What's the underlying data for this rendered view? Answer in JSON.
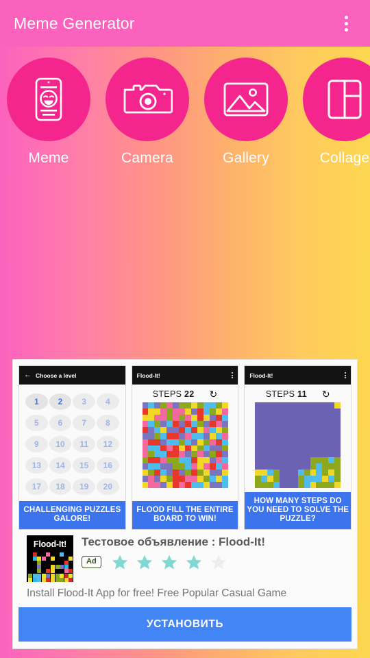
{
  "appbar": {
    "title": "Meme Generator",
    "overflow_icon": "more-vert-icon"
  },
  "shortcuts": [
    {
      "label": "Meme",
      "icon": "phone-smiley-icon"
    },
    {
      "label": "Camera",
      "icon": "camera-icon"
    },
    {
      "label": "Gallery",
      "icon": "image-icon"
    },
    {
      "label": "Collage",
      "icon": "collage-grid-icon"
    }
  ],
  "colors": {
    "appbar": "#FB62BE",
    "circle": "#F4268E",
    "gradient_start": "#FC62BE",
    "gradient_end": "#FDD74F",
    "install_button": "#4285F4",
    "caption_blue": "#3B74ED",
    "star_filled": "#7FD9D2",
    "star_empty": "#EDEDED",
    "ad_badge": "#31541d"
  },
  "ad": {
    "screenshots": [
      {
        "bar_title": "Choose a level",
        "bar_back_icon": "back-arrow-icon",
        "has_back": true,
        "has_menu": false,
        "caption": "CHALLENGING PUZZLES GALORE!",
        "levels": [
          "1",
          "2",
          "3",
          "4",
          "5",
          "6",
          "7",
          "8",
          "9",
          "10",
          "11",
          "12",
          "13",
          "14",
          "15",
          "16",
          "17",
          "18",
          "19",
          "20"
        ],
        "unlocked_levels": [
          "1",
          "2"
        ]
      },
      {
        "bar_title": "Flood-It!",
        "has_back": false,
        "has_menu": true,
        "menu_icon": "more-vert-icon",
        "steps_label": "STEPS",
        "steps_value": "22",
        "refresh_icon": "refresh-icon",
        "caption": "FLOOD FILL THE ENTIRE BOARD TO WIN!"
      },
      {
        "bar_title": "Flood-It!",
        "has_back": false,
        "has_menu": true,
        "menu_icon": "more-vert-icon",
        "steps_label": "STEPS",
        "steps_value": "11",
        "refresh_icon": "refresh-icon",
        "caption": "HOW MANY STEPS DO YOU NEED TO SOLVE THE PUZZLE?"
      }
    ],
    "icon_label": "Flood-It!",
    "title": "Тестовое объявление : Flood-It!",
    "badge": "Ad",
    "rating": 4,
    "rating_max": 5,
    "description": "Install Flood-It App for free! Free Popular Casual Game",
    "install_label": "УСТАНОВИТЬ"
  },
  "board_palette": [
    "#F2D727",
    "#4FBCEC",
    "#E8382B",
    "#7B74BE",
    "#F2699F",
    "#8DA81C"
  ],
  "board2_fill": "#6B62B4"
}
